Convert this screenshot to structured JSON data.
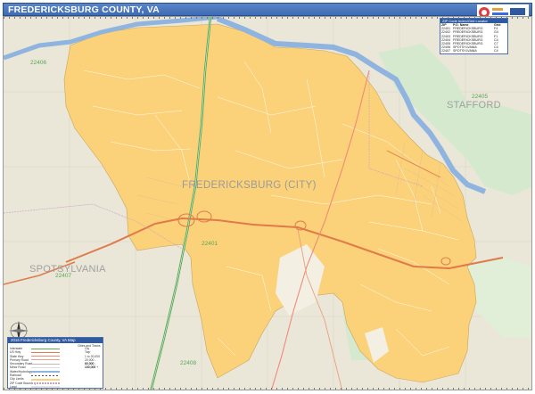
{
  "title": "FREDERICKSBURG COUNTY, VA",
  "colors": {
    "title_bar": "#3d6bb5",
    "city_fill": "#fbd279",
    "land": "#eae6d8",
    "park": "#d4e9cd",
    "river": "#8fb4e0",
    "interstate": "#5aaa5a",
    "highway": "#e07a4a",
    "zip_label": "#58a858",
    "place_label": "#9a9a9a"
  },
  "place_labels": {
    "city": "FREDERICKSBURG (CITY)",
    "stafford": "STAFFORD",
    "spotsylvania": "SPOTSYLVANIA"
  },
  "zip_labels": {
    "z22406": "22406",
    "z22405": "22405",
    "z22401": "22401",
    "z22407": "22407",
    "z22408": "22408"
  },
  "zip_index": {
    "title": "ZIP Code Index/Grid Locator",
    "columns": [
      "ZIP",
      "P.O. Name",
      "Grid"
    ],
    "rows": [
      {
        "zip": "22401",
        "name": "FREDERICKSBURG",
        "grid": "F4"
      },
      {
        "zip": "22402",
        "name": "FREDERICKSBURG",
        "grid": "G4"
      },
      {
        "zip": "22403",
        "name": "FREDERICKSBURG",
        "grid": "F1"
      },
      {
        "zip": "22404",
        "name": "FREDERICKSBURG",
        "grid": "C4"
      },
      {
        "zip": "22405",
        "name": "FREDERICKSBURG",
        "grid": "C7"
      },
      {
        "zip": "22406",
        "name": "SPOTSYLVANIA",
        "grid": "C4"
      },
      {
        "zip": "22407",
        "name": "SPOTSYLVANIA",
        "grid": "C4"
      }
    ]
  },
  "legend": {
    "title": "2016 Fredericksburg County, VA Map",
    "subtitle": "Cities and Towns",
    "rows": [
      {
        "label": "Interstate",
        "value": "Cty"
      },
      {
        "label": "US Hwy",
        "value": "Twp"
      },
      {
        "label": "State Hwy",
        "value": "1 to 20,000"
      },
      {
        "label": "Primary Road",
        "value": "20,000 - 60,000"
      },
      {
        "label": "Secondary Road",
        "value": "60,000 - 100,000"
      },
      {
        "label": "Minor Road",
        "value": "100,000 +"
      },
      {
        "label": "Water/Hydrology",
        "value": ""
      },
      {
        "label": "Railroad",
        "value": ""
      },
      {
        "label": "City Limits",
        "value": ""
      },
      {
        "label": "ZIP Code Boundary",
        "value": ""
      },
      {
        "label": "Land",
        "value": ""
      }
    ]
  }
}
